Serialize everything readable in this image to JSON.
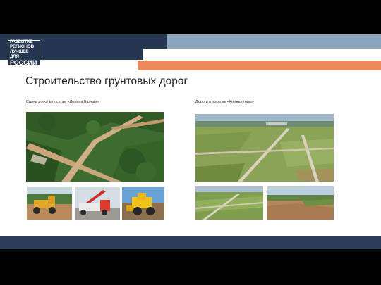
{
  "logo": {
    "lines": [
      "РАЗВИТИЕ",
      "РЕГИОНОВ",
      "ЛУЧШЕЕ ДЛЯ",
      "РОССИИ"
    ]
  },
  "slide": {
    "title": "Строительство грунтовых дорог",
    "left_caption": "Сдача дорог в поселке «Долина Вазузы»",
    "right_caption": "Дороги в поселке «Княжьи горы»"
  },
  "colors": {
    "navy": "#253751",
    "blue": "#8aa5bc",
    "orange": "#ea8a5c",
    "footer": "#2c3e57"
  }
}
